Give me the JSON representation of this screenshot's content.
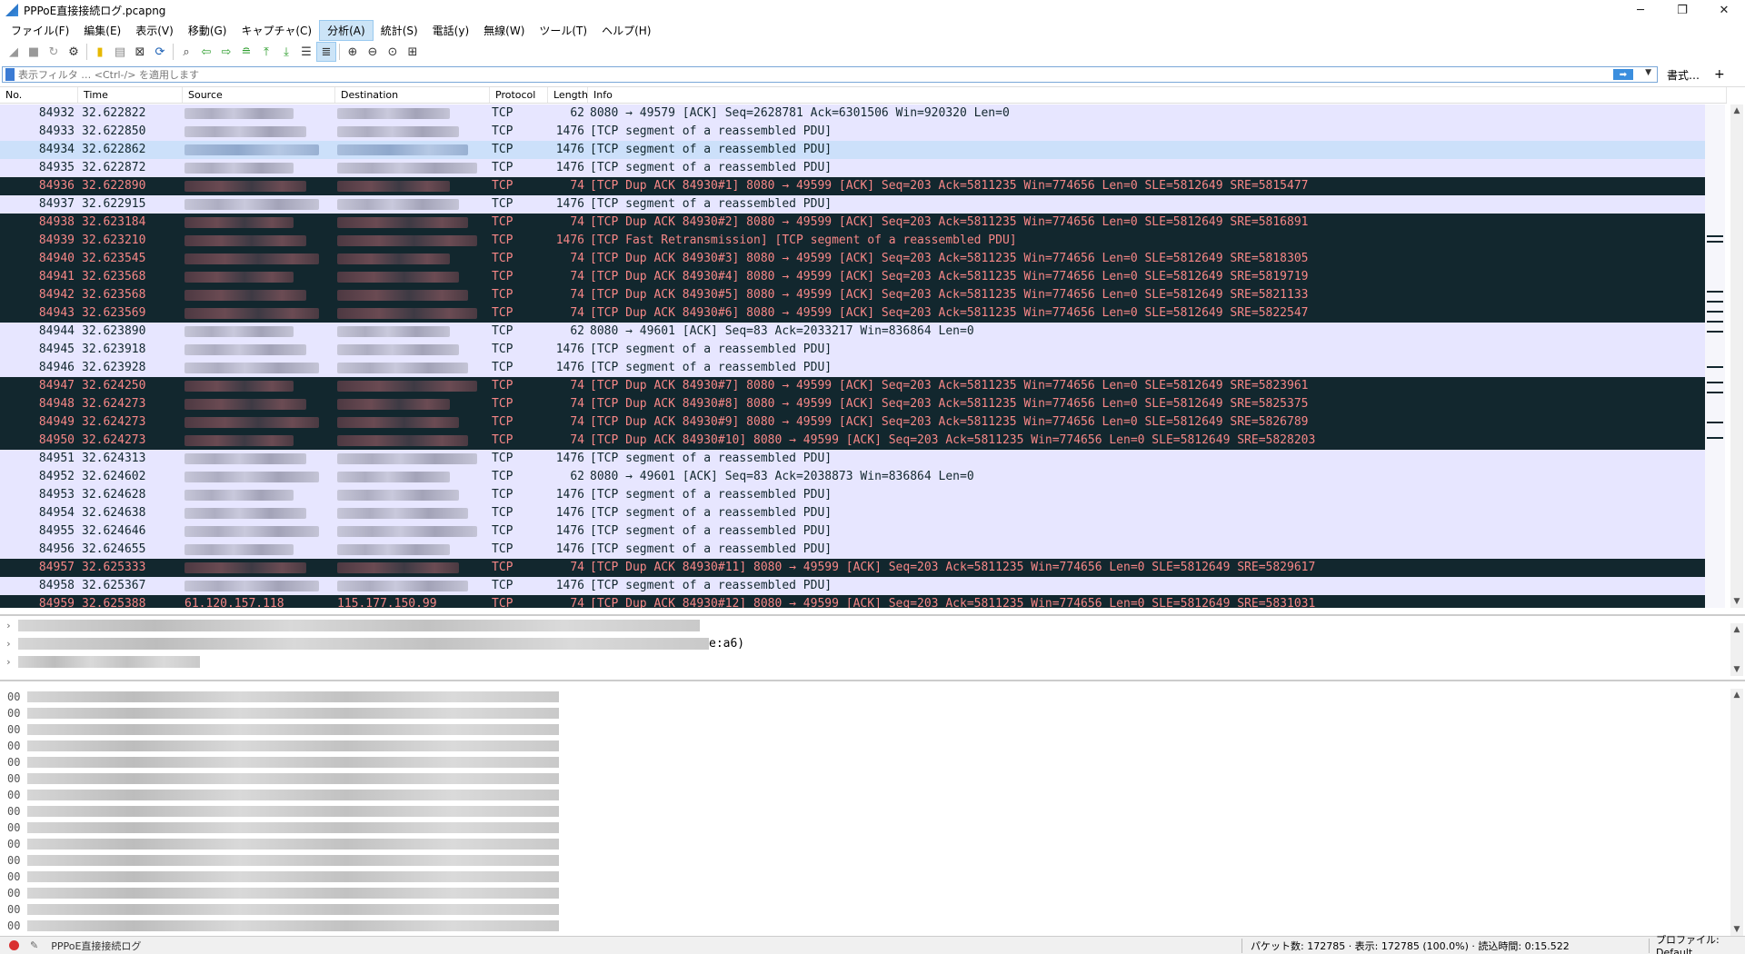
{
  "window": {
    "title": "PPPoE直接接続ログ.pcapng",
    "controls": {
      "minimize": "─",
      "maximize": "❐",
      "close": "✕"
    }
  },
  "menu": [
    "ファイル(F)",
    "編集(E)",
    "表示(V)",
    "移動(G)",
    "キャプチャ(C)",
    "分析(A)",
    "統計(S)",
    "電話(y)",
    "無線(W)",
    "ツール(T)",
    "ヘルプ(H)"
  ],
  "menu_active": "分析(A)",
  "filter": {
    "placeholder": "表示フィルタ … <Ctrl-/> を適用します",
    "expressions_label": "書式…",
    "add_label": "+"
  },
  "columns": [
    "No.",
    "Time",
    "Source",
    "Destination",
    "Protocol",
    "Length",
    "Info"
  ],
  "colors": {
    "normal_bg": "#e7e6ff",
    "dark_bg": "#12272e",
    "dark_fg": "#f78787",
    "selected_bg": "#cce0fa"
  },
  "packets": [
    {
      "no": "84932",
      "time": "32.622822",
      "proto": "TCP",
      "len": "62",
      "info": "8080 → 49579 [ACK] Seq=2628781 Ack=6301506 Win=920320 Len=0",
      "style": "normal"
    },
    {
      "no": "84933",
      "time": "32.622850",
      "proto": "TCP",
      "len": "1476",
      "info": "[TCP segment of a reassembled PDU]",
      "style": "normal"
    },
    {
      "no": "84934",
      "time": "32.622862",
      "proto": "TCP",
      "len": "1476",
      "info": "[TCP segment of a reassembled PDU]",
      "style": "selected"
    },
    {
      "no": "84935",
      "time": "32.622872",
      "proto": "TCP",
      "len": "1476",
      "info": "[TCP segment of a reassembled PDU]",
      "style": "normal"
    },
    {
      "no": "84936",
      "time": "32.622890",
      "proto": "TCP",
      "len": "74",
      "info": "[TCP Dup ACK 84930#1] 8080 → 49599 [ACK] Seq=203 Ack=5811235 Win=774656 Len=0 SLE=5812649 SRE=5815477",
      "style": "dark"
    },
    {
      "no": "84937",
      "time": "32.622915",
      "proto": "TCP",
      "len": "1476",
      "info": "[TCP segment of a reassembled PDU]",
      "style": "normal"
    },
    {
      "no": "84938",
      "time": "32.623184",
      "proto": "TCP",
      "len": "74",
      "info": "[TCP Dup ACK 84930#2] 8080 → 49599 [ACK] Seq=203 Ack=5811235 Win=774656 Len=0 SLE=5812649 SRE=5816891",
      "style": "dark"
    },
    {
      "no": "84939",
      "time": "32.623210",
      "proto": "TCP",
      "len": "1476",
      "info": "[TCP Fast Retransmission] [TCP segment of a reassembled PDU]",
      "style": "dark"
    },
    {
      "no": "84940",
      "time": "32.623545",
      "proto": "TCP",
      "len": "74",
      "info": "[TCP Dup ACK 84930#3] 8080 → 49599 [ACK] Seq=203 Ack=5811235 Win=774656 Len=0 SLE=5812649 SRE=5818305",
      "style": "dark"
    },
    {
      "no": "84941",
      "time": "32.623568",
      "proto": "TCP",
      "len": "74",
      "info": "[TCP Dup ACK 84930#4] 8080 → 49599 [ACK] Seq=203 Ack=5811235 Win=774656 Len=0 SLE=5812649 SRE=5819719",
      "style": "dark"
    },
    {
      "no": "84942",
      "time": "32.623568",
      "proto": "TCP",
      "len": "74",
      "info": "[TCP Dup ACK 84930#5] 8080 → 49599 [ACK] Seq=203 Ack=5811235 Win=774656 Len=0 SLE=5812649 SRE=5821133",
      "style": "dark"
    },
    {
      "no": "84943",
      "time": "32.623569",
      "proto": "TCP",
      "len": "74",
      "info": "[TCP Dup ACK 84930#6] 8080 → 49599 [ACK] Seq=203 Ack=5811235 Win=774656 Len=0 SLE=5812649 SRE=5822547",
      "style": "dark"
    },
    {
      "no": "84944",
      "time": "32.623890",
      "proto": "TCP",
      "len": "62",
      "info": "8080 → 49601 [ACK] Seq=83 Ack=2033217 Win=836864 Len=0",
      "style": "normal"
    },
    {
      "no": "84945",
      "time": "32.623918",
      "proto": "TCP",
      "len": "1476",
      "info": "[TCP segment of a reassembled PDU]",
      "style": "normal"
    },
    {
      "no": "84946",
      "time": "32.623928",
      "proto": "TCP",
      "len": "1476",
      "info": "[TCP segment of a reassembled PDU]",
      "style": "normal"
    },
    {
      "no": "84947",
      "time": "32.624250",
      "proto": "TCP",
      "len": "74",
      "info": "[TCP Dup ACK 84930#7] 8080 → 49599 [ACK] Seq=203 Ack=5811235 Win=774656 Len=0 SLE=5812649 SRE=5823961",
      "style": "dark"
    },
    {
      "no": "84948",
      "time": "32.624273",
      "proto": "TCP",
      "len": "74",
      "info": "[TCP Dup ACK 84930#8] 8080 → 49599 [ACK] Seq=203 Ack=5811235 Win=774656 Len=0 SLE=5812649 SRE=5825375",
      "style": "dark"
    },
    {
      "no": "84949",
      "time": "32.624273",
      "proto": "TCP",
      "len": "74",
      "info": "[TCP Dup ACK 84930#9] 8080 → 49599 [ACK] Seq=203 Ack=5811235 Win=774656 Len=0 SLE=5812649 SRE=5826789",
      "style": "dark"
    },
    {
      "no": "84950",
      "time": "32.624273",
      "proto": "TCP",
      "len": "74",
      "info": "[TCP Dup ACK 84930#10] 8080 → 49599 [ACK] Seq=203 Ack=5811235 Win=774656 Len=0 SLE=5812649 SRE=5828203",
      "style": "dark"
    },
    {
      "no": "84951",
      "time": "32.624313",
      "proto": "TCP",
      "len": "1476",
      "info": "[TCP segment of a reassembled PDU]",
      "style": "normal"
    },
    {
      "no": "84952",
      "time": "32.624602",
      "proto": "TCP",
      "len": "62",
      "info": "8080 → 49601 [ACK] Seq=83 Ack=2038873 Win=836864 Len=0",
      "style": "normal"
    },
    {
      "no": "84953",
      "time": "32.624628",
      "proto": "TCP",
      "len": "1476",
      "info": "[TCP segment of a reassembled PDU]",
      "style": "normal"
    },
    {
      "no": "84954",
      "time": "32.624638",
      "proto": "TCP",
      "len": "1476",
      "info": "[TCP segment of a reassembled PDU]",
      "style": "normal"
    },
    {
      "no": "84955",
      "time": "32.624646",
      "proto": "TCP",
      "len": "1476",
      "info": "[TCP segment of a reassembled PDU]",
      "style": "normal"
    },
    {
      "no": "84956",
      "time": "32.624655",
      "proto": "TCP",
      "len": "1476",
      "info": "[TCP segment of a reassembled PDU]",
      "style": "normal"
    },
    {
      "no": "84957",
      "time": "32.625333",
      "proto": "TCP",
      "len": "74",
      "info": "[TCP Dup ACK 84930#11] 8080 → 49599 [ACK] Seq=203 Ack=5811235 Win=774656 Len=0 SLE=5812649 SRE=5829617",
      "style": "dark"
    },
    {
      "no": "84958",
      "time": "32.625367",
      "proto": "TCP",
      "len": "1476",
      "info": "[TCP segment of a reassembled PDU]",
      "style": "normal"
    },
    {
      "no": "84959",
      "time": "32.625388",
      "proto": "TCP",
      "len": "74",
      "info": "[TCP Dup ACK 84930#12] 8080 → 49599 [ACK] Seq=203 Ack=5811235 Win=774656 Len=0 SLE=5812649 SRE=5831031",
      "style": "dark",
      "src": "61.120.157.118",
      "dst": "115.177.150.99"
    }
  ],
  "details": {
    "visible_fragment": "e:a6)"
  },
  "bytes": {
    "offset_prefix": "00"
  },
  "status": {
    "file": "PPPoE直接接続ログ",
    "packets": "パケット数: 172785 · 表示: 172785 (100.0%) · 読込時間: 0:15.522",
    "profile": "プロファイル: Default"
  }
}
